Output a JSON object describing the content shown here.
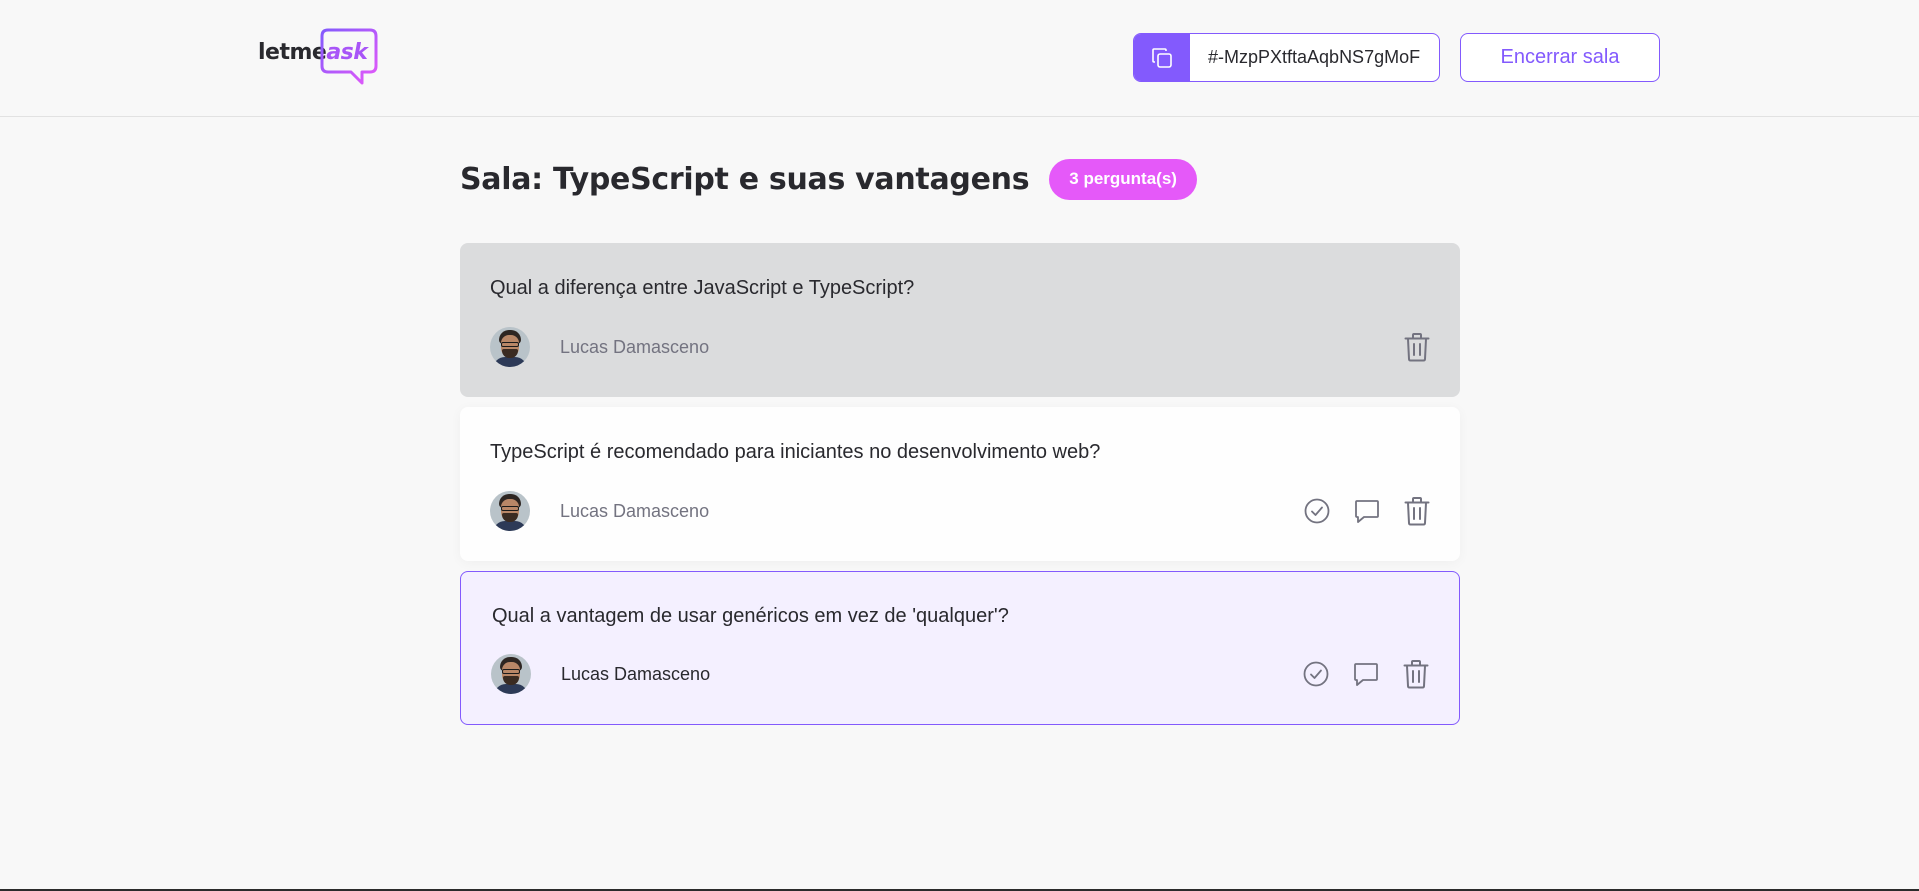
{
  "header": {
    "logo": {
      "text_main": "letme",
      "text_accent": "ask"
    },
    "room_code": "#-MzpPXtftaAqbNS7gMoF",
    "end_button_label": "Encerrar sala"
  },
  "room": {
    "title": "Sala: TypeScript e suas vantagens",
    "question_count_label": "3 pergunta(s)"
  },
  "questions": [
    {
      "content": "Qual a diferença entre JavaScript e TypeScript?",
      "author": "Lucas Damasceno",
      "state": "answered"
    },
    {
      "content": "TypeScript é recomendado para iniciantes no desenvolvimento web?",
      "author": "Lucas Damasceno",
      "state": "normal"
    },
    {
      "content": "Qual a vantagem de usar genéricos em vez de 'qualquer'?",
      "author": "Lucas Damasceno",
      "state": "highlighted"
    }
  ],
  "colors": {
    "primary": "#835afd",
    "pink": "#e559f9",
    "answered_bg": "#dbdcdd",
    "highlighted_bg": "#f4f0ff",
    "text": "#29292e",
    "muted": "#737380"
  },
  "icons": [
    "copy-icon",
    "check-icon",
    "answer-icon",
    "delete-icon"
  ]
}
